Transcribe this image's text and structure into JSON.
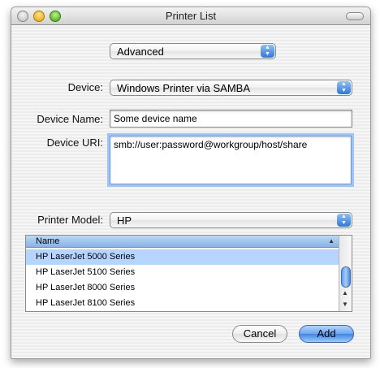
{
  "window": {
    "title": "Printer List"
  },
  "mode_popup": {
    "value": "Advanced"
  },
  "device": {
    "label": "Device:",
    "value": "Windows Printer via SAMBA"
  },
  "device_name": {
    "label": "Device Name:",
    "value": "Some device name"
  },
  "device_uri": {
    "label": "Device URI:",
    "value": "smb://user:password@workgroup/host/share"
  },
  "printer_model": {
    "label": "Printer Model:",
    "value": "HP"
  },
  "model_list": {
    "column_header": "Name",
    "rows": [
      {
        "name": "HP LaserJet 5000 Series",
        "selected": true
      },
      {
        "name": "HP LaserJet 5100 Series",
        "selected": false
      },
      {
        "name": "HP LaserJet 8000 Series",
        "selected": false
      },
      {
        "name": "HP LaserJet 8100 Series",
        "selected": false
      }
    ]
  },
  "buttons": {
    "cancel": "Cancel",
    "add": "Add"
  },
  "colors": {
    "accent": "#3d86e6",
    "selection": "#b5d5ff"
  }
}
